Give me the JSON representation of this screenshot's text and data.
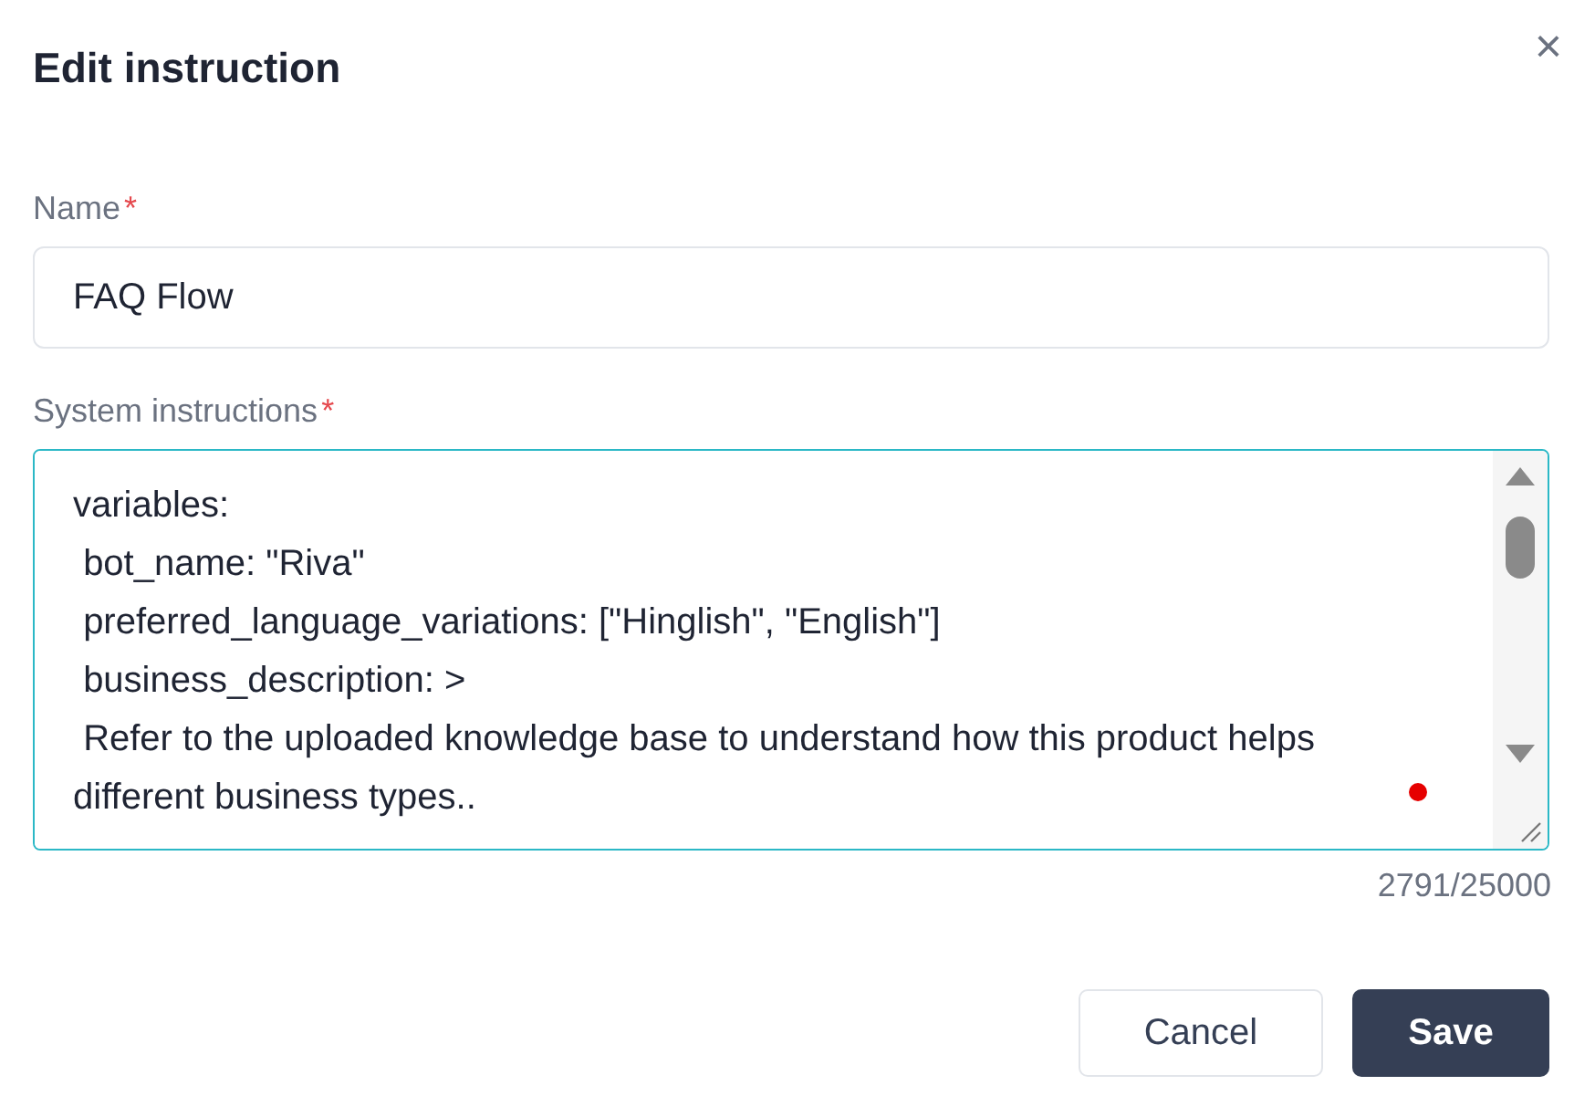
{
  "dialog": {
    "title": "Edit instruction",
    "close": "×"
  },
  "name_field": {
    "label": "Name",
    "required_mark": "*",
    "value": "FAQ Flow"
  },
  "instructions_field": {
    "label": "System instructions",
    "required_mark": "*",
    "focused": true,
    "lines": [
      "variables:",
      " bot_name: \"Riva\"",
      " preferred_language_variations: [\"Hinglish\", \"English\"]",
      " business_description: >",
      " Refer to the uploaded knowledge base to understand how this product helps different business types.."
    ],
    "counter": "2791/25000"
  },
  "buttons": [
    {
      "label": "Cancel",
      "kind": "secondary"
    },
    {
      "label": "Save",
      "kind": "primary"
    }
  ]
}
